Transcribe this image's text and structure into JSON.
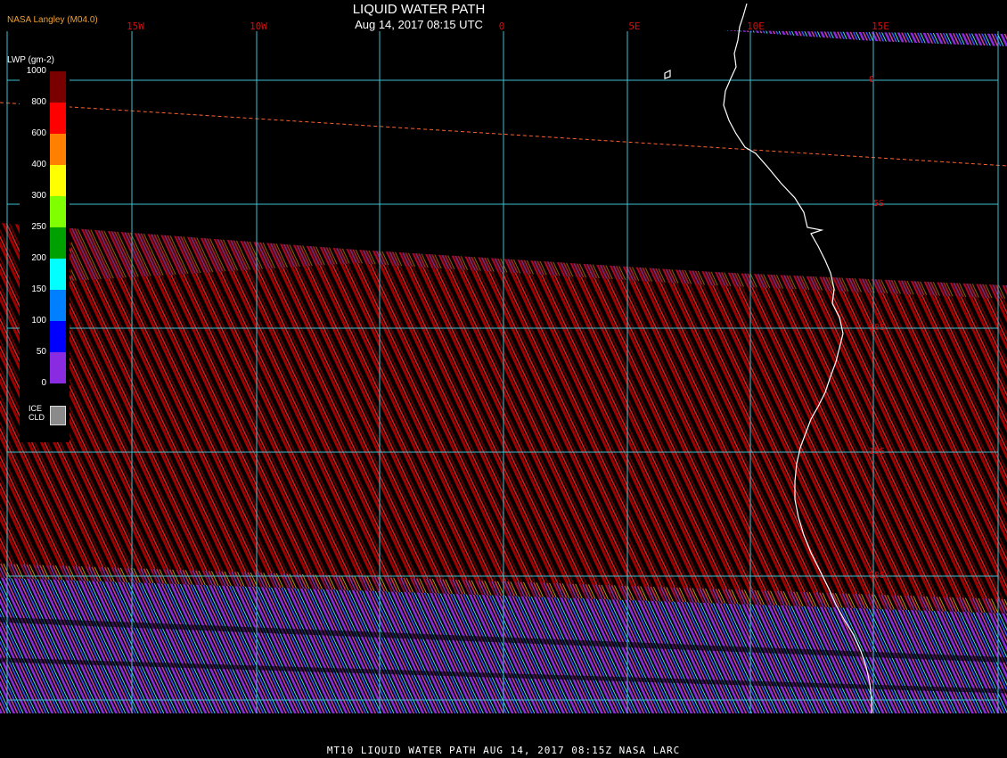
{
  "header": {
    "title": "LIQUID WATER PATH",
    "subtitle": "Aug 14, 2017 08:15 UTC",
    "credit": "NASA Langley (M04.0)"
  },
  "footer": {
    "text": "MT10  LIQUID WATER PATH   AUG 14, 2017 08:15Z   NASA LARC"
  },
  "grid": {
    "lon_labels": [
      "15W",
      "10W",
      "0",
      "5E",
      "10E",
      "15E"
    ],
    "lat_labels": [
      "0",
      "5S",
      "10S",
      "15S",
      "20S"
    ]
  },
  "legend": {
    "title": "LWP (gm-2)",
    "ticks": [
      "1000",
      "800",
      "600",
      "400",
      "300",
      "250",
      "200",
      "150",
      "100",
      "50",
      "0"
    ],
    "colors": [
      "#7a0000",
      "#ff0000",
      "#ff7f00",
      "#ffff00",
      "#7fff00",
      "#00a000",
      "#00ffff",
      "#0080ff",
      "#0000ff",
      "#8a2be2"
    ],
    "ice_label": "ICE\nCLD",
    "ice_color": "#8a8a8a"
  },
  "colors": {
    "grid": "#40c0d0",
    "label_red": "#d01010",
    "credit": "#f0a030",
    "coast": "#ffffff"
  }
}
